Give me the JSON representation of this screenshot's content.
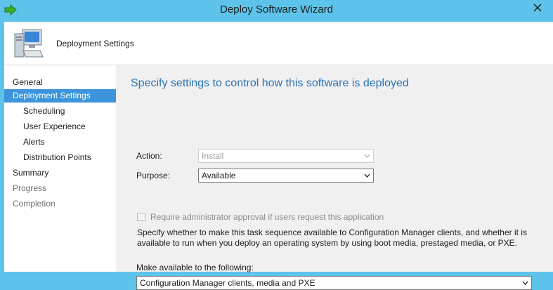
{
  "window": {
    "title": "Deploy Software Wizard"
  },
  "header": {
    "title": "Deployment Settings"
  },
  "nav": {
    "items": [
      {
        "label": "General",
        "state": "normal"
      },
      {
        "label": "Deployment Settings",
        "state": "active"
      },
      {
        "label": "Scheduling",
        "state": "normal"
      },
      {
        "label": "User Experience",
        "state": "normal"
      },
      {
        "label": "Alerts",
        "state": "normal"
      },
      {
        "label": "Distribution Points",
        "state": "normal"
      },
      {
        "label": "Summary",
        "state": "normal"
      },
      {
        "label": "Progress",
        "state": "disabled"
      },
      {
        "label": "Completion",
        "state": "disabled"
      }
    ]
  },
  "content": {
    "heading": "Specify settings to control how this software is deployed",
    "action": {
      "label": "Action:",
      "value": "Install",
      "enabled": false
    },
    "purpose": {
      "label": "Purpose:",
      "value": "Available"
    },
    "approval": {
      "label": "Require administrator approval if users request this application",
      "checked": false,
      "enabled": false
    },
    "description": "Specify whether to make this task sequence available to Configuration Manager clients, and whether it is available to run when you deploy an operating system by using boot media, prestaged media, or PXE.",
    "make_available": {
      "label": "Make available to the following:",
      "value": "Configuration Manager clients, media and PXE"
    }
  },
  "colors": {
    "titlebar": "#5ec3ea",
    "nav_active": "#3c95dc",
    "heading": "#2a73b6",
    "content_bg": "#f0f0f0"
  },
  "icons": {
    "app": "green-arrow-icon",
    "header": "computer-icon",
    "close": "close-icon"
  }
}
